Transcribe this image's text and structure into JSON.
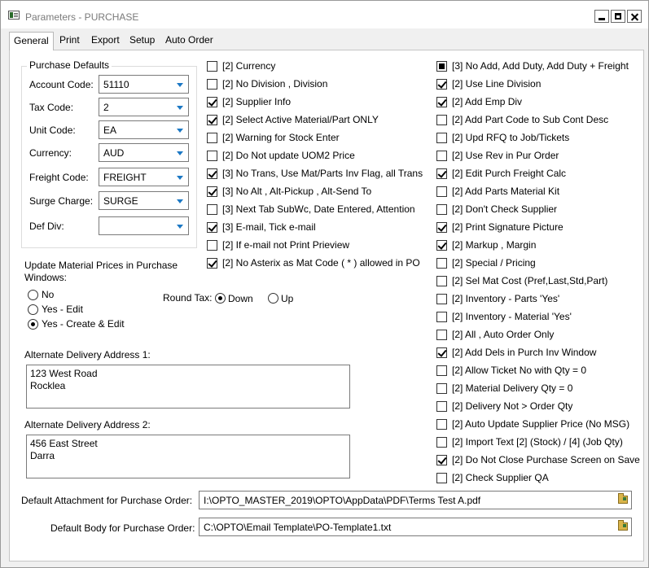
{
  "window": {
    "title": "Parameters - PURCHASE"
  },
  "tabs": [
    "General",
    "Print",
    "Export",
    "Setup",
    "Auto Order"
  ],
  "purchase_defaults": {
    "title": "Purchase Defaults",
    "fields": [
      {
        "label": "Account Code:",
        "value": "51110"
      },
      {
        "label": "Tax Code:",
        "value": "2"
      },
      {
        "label": "Unit Code:",
        "value": "EA"
      },
      {
        "label": "Currency:",
        "value": "AUD"
      },
      {
        "label": "Freight Code:",
        "value": "FREIGHT"
      },
      {
        "label": "Surge Charge:",
        "value": "SURGE"
      },
      {
        "label": "Def Div:",
        "value": ""
      }
    ]
  },
  "update_prices": {
    "label": "Update Material Prices in Purchase Windows:",
    "options": [
      "No",
      "Yes - Edit",
      "Yes - Create & Edit"
    ],
    "selected": 2
  },
  "round_tax": {
    "label": "Round Tax:",
    "options": [
      "Down",
      "Up"
    ],
    "selected": 0
  },
  "alt_address_1": {
    "label": "Alternate Delivery Address 1:",
    "lines": [
      "123 West Road",
      "Rocklea"
    ]
  },
  "alt_address_2": {
    "label": "Alternate Delivery Address 2:",
    "lines": [
      "456 East Street",
      "Darra"
    ]
  },
  "default_attachment": {
    "label": "Default Attachment for Purchase Order:",
    "value": "I:\\OPTO_MASTER_2019\\OPTO\\AppData\\PDF\\Terms Test A.pdf"
  },
  "default_body": {
    "label": "Default Body for Purchase Order:",
    "value": "C:\\OPTO\\Email Template\\PO-Template1.txt"
  },
  "checks_middle": [
    {
      "label": "[2] Currency",
      "state": "unchecked"
    },
    {
      "label": "[2] No Division , Division",
      "state": "unchecked"
    },
    {
      "label": "[2] Supplier Info",
      "state": "checked"
    },
    {
      "label": "[2] Select Active Material/Part ONLY",
      "state": "checked"
    },
    {
      "label": "[2] Warning for Stock Enter",
      "state": "unchecked"
    },
    {
      "label": "[2] Do Not update UOM2 Price",
      "state": "unchecked"
    },
    {
      "label": "[3] No Trans, Use Mat/Parts Inv Flag, all Trans",
      "state": "checked"
    },
    {
      "label": "[3] No Alt , Alt-Pickup , Alt-Send To",
      "state": "checked"
    },
    {
      "label": "[3] Next Tab SubWc, Date Entered, Attention",
      "state": "unchecked"
    },
    {
      "label": "[3] E-mail, Tick e-mail",
      "state": "checked"
    },
    {
      "label": "[2] If e-mail not Print Prieview",
      "state": "unchecked"
    },
    {
      "label": "[2] No Asterix as Mat Code ( * ) allowed in PO",
      "state": "checked"
    }
  ],
  "checks_right": [
    {
      "label": "[3] No Add, Add Duty, Add Duty + Freight",
      "state": "indeterminate"
    },
    {
      "label": "[2] Use Line Division",
      "state": "checked"
    },
    {
      "label": "[2] Add Emp Div",
      "state": "checked"
    },
    {
      "label": "[2] Add Part Code to Sub Cont Desc",
      "state": "unchecked"
    },
    {
      "label": "[2] Upd RFQ to Job/Tickets",
      "state": "unchecked"
    },
    {
      "label": "[2] Use Rev in Pur Order",
      "state": "unchecked"
    },
    {
      "label": "[2] Edit Purch Freight Calc",
      "state": "checked"
    },
    {
      "label": "[2] Add Parts Material Kit",
      "state": "unchecked"
    },
    {
      "label": "[2] Don't Check Supplier",
      "state": "unchecked"
    },
    {
      "label": "[2] Print Signature Picture",
      "state": "checked"
    },
    {
      "label": "[2] Markup , Margin",
      "state": "checked"
    },
    {
      "label": "[2] Special / Pricing",
      "state": "unchecked"
    },
    {
      "label": "[2] Sel Mat Cost (Pref,Last,Std,Part)",
      "state": "unchecked"
    },
    {
      "label": "[2] Inventory - Parts 'Yes'",
      "state": "unchecked"
    },
    {
      "label": "[2] Inventory - Material 'Yes'",
      "state": "unchecked"
    },
    {
      "label": "[2] All , Auto Order Only",
      "state": "unchecked"
    },
    {
      "label": "[2] Add Dels in Purch Inv Window",
      "state": "checked"
    },
    {
      "label": "[2] Allow Ticket No with Qty = 0",
      "state": "unchecked"
    },
    {
      "label": "[2] Material Delivery  Qty = 0",
      "state": "unchecked"
    },
    {
      "label": "[2] Delivery Not > Order Qty",
      "state": "unchecked"
    },
    {
      "label": "[2] Auto Update Supplier Price (No MSG)",
      "state": "unchecked"
    },
    {
      "label": "[2] Import Text [2] (Stock) / [4] (Job Qty)",
      "state": "unchecked"
    },
    {
      "label": "[2] Do Not Close Purchase Screen on Save",
      "state": "checked"
    },
    {
      "label": "[2] Check Supplier QA",
      "state": "unchecked"
    }
  ]
}
